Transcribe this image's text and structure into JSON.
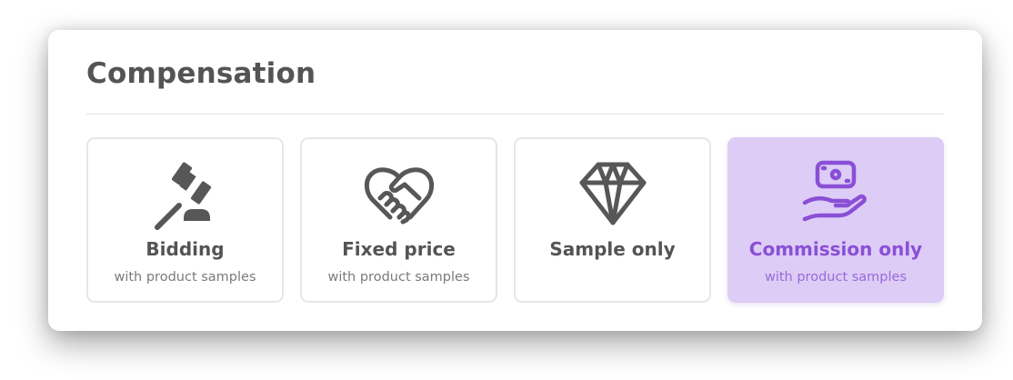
{
  "section": {
    "title": "Compensation"
  },
  "options": [
    {
      "label": "Bidding",
      "subtitle": "with product samples",
      "icon": "gavel-icon",
      "selected": false
    },
    {
      "label": "Fixed price",
      "subtitle": "with product samples",
      "icon": "handshake-icon",
      "selected": false
    },
    {
      "label": "Sample only",
      "subtitle": "",
      "icon": "diamond-icon",
      "selected": false
    },
    {
      "label": "Commission only",
      "subtitle": "with product samples",
      "icon": "money-in-hand-icon",
      "selected": true
    }
  ],
  "colors": {
    "text": "#545454",
    "subtext": "#7a7a7a",
    "border": "#e6e6e6",
    "selected_bg": "#ddccf6",
    "selected_text": "#8a4fd6"
  }
}
